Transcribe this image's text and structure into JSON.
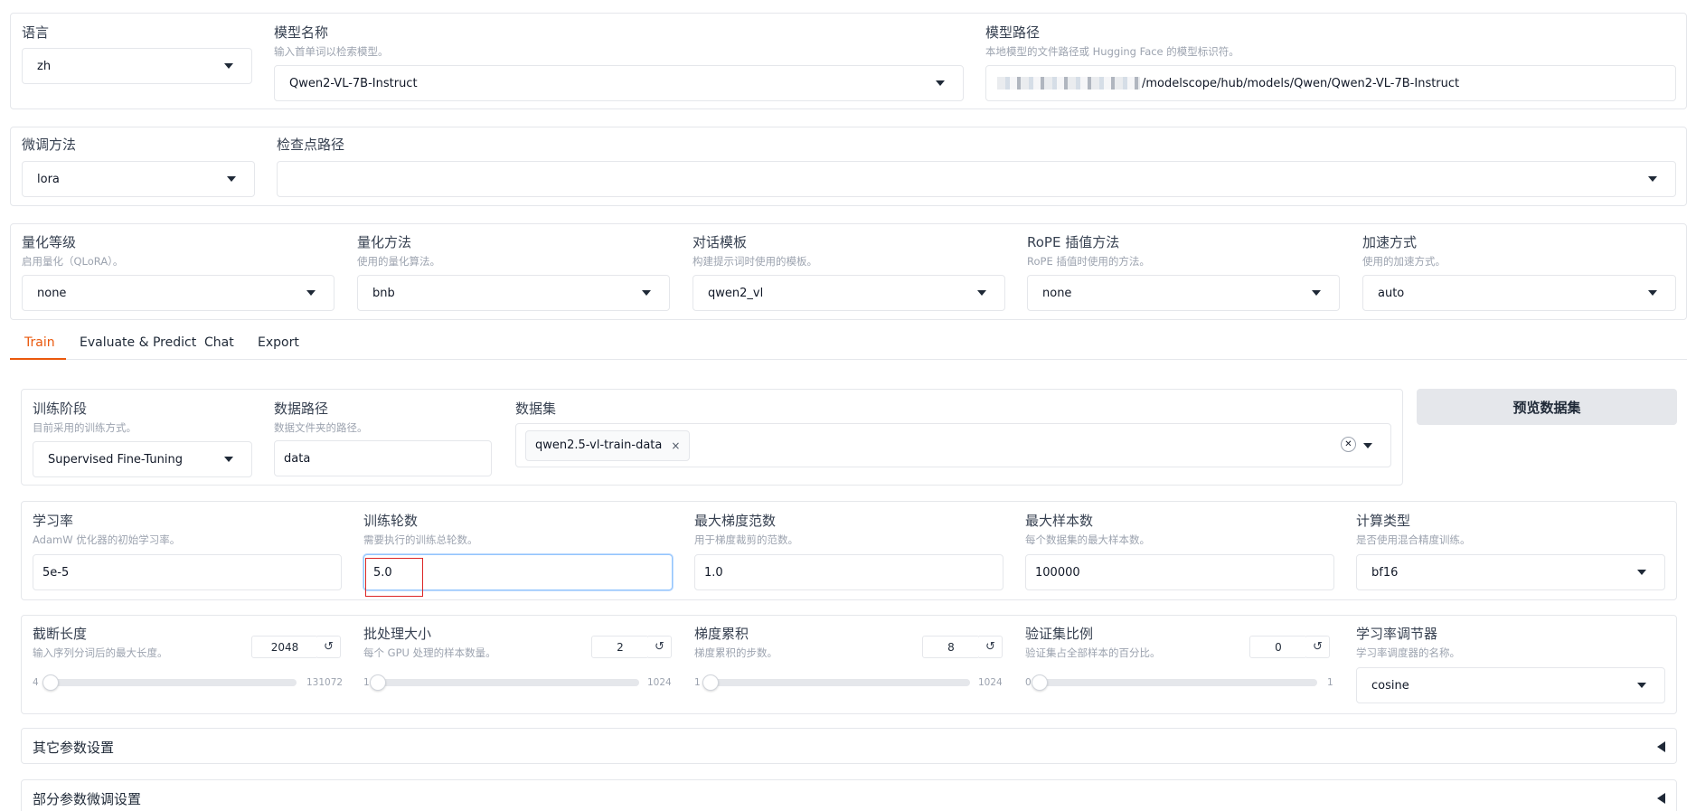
{
  "top": {
    "lang": {
      "label": "语言",
      "value": "zh"
    },
    "model_name": {
      "label": "模型名称",
      "info": "输入首单词以检索模型。",
      "value": "Qwen2-VL-7B-Instruct"
    },
    "model_path": {
      "label": "模型路径",
      "info": "本地模型的文件路径或 Hugging Face 的模型标识符。",
      "value": "/modelscope/hub/models/Qwen/Qwen2-VL-7B-Instruct"
    }
  },
  "finetune": {
    "method": {
      "label": "微调方法",
      "value": "lora"
    },
    "checkpoint": {
      "label": "检查点路径",
      "value": ""
    }
  },
  "advanced": {
    "quant_bit": {
      "label": "量化等级",
      "info": "启用量化（QLoRA）。",
      "value": "none"
    },
    "quant_method": {
      "label": "量化方法",
      "info": "使用的量化算法。",
      "value": "bnb"
    },
    "template": {
      "label": "对话模板",
      "info": "构建提示词时使用的模板。",
      "value": "qwen2_vl"
    },
    "rope": {
      "label": "RoPE 插值方法",
      "info": "RoPE 插值时使用的方法。",
      "value": "none"
    },
    "booster": {
      "label": "加速方式",
      "info": "使用的加速方式。",
      "value": "auto"
    }
  },
  "tabs": [
    "Train",
    "Evaluate & Predict",
    "Chat",
    "Export"
  ],
  "train": {
    "stage": {
      "label": "训练阶段",
      "info": "目前采用的训练方式。",
      "value": "Supervised Fine-Tuning"
    },
    "dataset_dir": {
      "label": "数据路径",
      "info": "数据文件夹的路径。",
      "value": "data"
    },
    "dataset": {
      "label": "数据集",
      "chip": "qwen2.5-vl-train-data",
      "chip_close": "×",
      "clear": "✕"
    },
    "preview_button": "预览数据集",
    "learning_rate": {
      "label": "学习率",
      "info": "AdamW 优化器的初始学习率。",
      "value": "5e-5"
    },
    "epochs": {
      "label": "训练轮数",
      "info": "需要执行的训练总轮数。",
      "value": "5.0"
    },
    "max_grad_norm": {
      "label": "最大梯度范数",
      "info": "用于梯度裁剪的范数。",
      "value": "1.0"
    },
    "max_samples": {
      "label": "最大样本数",
      "info": "每个数据集的最大样本数。",
      "value": "100000"
    },
    "compute_type": {
      "label": "计算类型",
      "info": "是否使用混合精度训练。",
      "value": "bf16"
    },
    "cutoff_len": {
      "label": "截断长度",
      "info": "输入序列分词后的最大长度。",
      "value": "2048",
      "min": "4",
      "max": "131072",
      "fraction": 0.0156
    },
    "batch_size": {
      "label": "批处理大小",
      "info": "每个 GPU 处理的样本数量。",
      "value": "2",
      "min": "1",
      "max": "1024",
      "fraction": 0.001
    },
    "grad_accum": {
      "label": "梯度累积",
      "info": "梯度累积的步数。",
      "value": "8",
      "min": "1",
      "max": "1024",
      "fraction": 0.0068
    },
    "val_size": {
      "label": "验证集比例",
      "info": "验证集占全部样本的百分比。",
      "value": "0",
      "min": "0",
      "max": "1",
      "fraction": 0.0
    },
    "lr_scheduler": {
      "label": "学习率调节器",
      "info": "学习率调度器的名称。",
      "value": "cosine"
    },
    "reset_icon": "↺"
  },
  "accordions": {
    "extra": "其它参数设置",
    "freeze": "部分参数微调设置"
  },
  "colors": {
    "accent": "#ea580c",
    "annotation": "#dc2626"
  }
}
